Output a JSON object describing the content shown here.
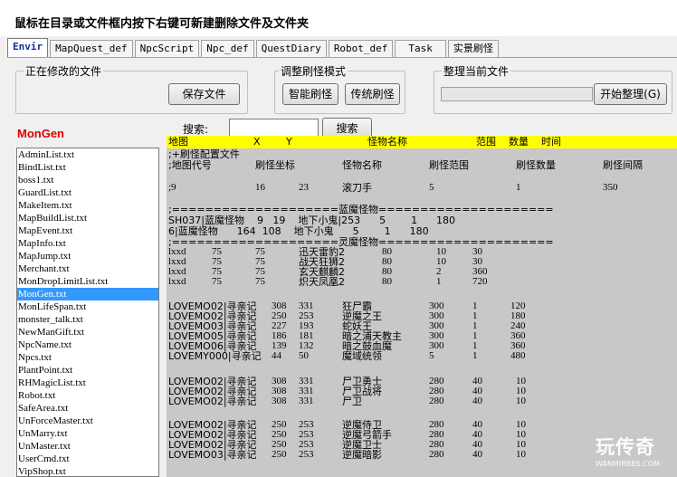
{
  "window": {
    "title": "鼠标在目录或文件框内按下右键可新建删除文件及文件夹"
  },
  "tabs": [
    {
      "label": "Envir",
      "active": true
    },
    {
      "label": "MapQuest_def",
      "active": false
    },
    {
      "label": "NpcScript",
      "active": false
    },
    {
      "label": "Npc_def",
      "active": false
    },
    {
      "label": "QuestDiary",
      "active": false
    },
    {
      "label": "Robot_def",
      "active": false
    },
    {
      "label": "Task",
      "active": false
    },
    {
      "label": "实景刷怪",
      "active": false
    }
  ],
  "editing_group": {
    "label": "正在修改的文件",
    "save_button": "保存文件"
  },
  "mode_group": {
    "label": "调整刷怪模式",
    "smart_button": "智能刷怪",
    "traditional_button": "传统刷怪"
  },
  "tidy_group": {
    "label": "整理当前文件",
    "progress": 0,
    "start_button": "开始整理(G)"
  },
  "current_file_label": "MonGen",
  "search": {
    "label": "搜索:",
    "value": "",
    "button": "搜索"
  },
  "file_list": [
    {
      "name": "AdminList.txt",
      "selected": false
    },
    {
      "name": "BindList.txt",
      "selected": false
    },
    {
      "name": "boss1.txt",
      "selected": false
    },
    {
      "name": "GuardList.txt",
      "selected": false
    },
    {
      "name": "MakeItem.txt",
      "selected": false
    },
    {
      "name": "MapBuildList.txt",
      "selected": false
    },
    {
      "name": "MapEvent.txt",
      "selected": false
    },
    {
      "name": "MapInfo.txt",
      "selected": false
    },
    {
      "name": "MapJump.txt",
      "selected": false
    },
    {
      "name": "Merchant.txt",
      "selected": false
    },
    {
      "name": "MonDropLimitList.txt",
      "selected": false
    },
    {
      "name": "MonGen.txt",
      "selected": true
    },
    {
      "name": "MonLifeSpan.txt",
      "selected": false
    },
    {
      "name": "monster_talk.txt",
      "selected": false
    },
    {
      "name": "NewManGift.txt",
      "selected": false
    },
    {
      "name": "NpcName.txt",
      "selected": false
    },
    {
      "name": "Npcs.txt",
      "selected": false
    },
    {
      "name": "PlantPoint.txt",
      "selected": false
    },
    {
      "name": "RHMagicList.txt",
      "selected": false
    },
    {
      "name": "Robot.txt",
      "selected": false
    },
    {
      "name": "SafeArea.txt",
      "selected": false
    },
    {
      "name": "UnForceMaster.txt",
      "selected": false
    },
    {
      "name": "UnMarry.txt",
      "selected": false
    },
    {
      "name": "UnMaster.txt",
      "selected": false
    },
    {
      "name": "UserCmd.txt",
      "selected": false
    },
    {
      "name": "VipShop.txt",
      "selected": false
    }
  ],
  "content_header": {
    "map": "地图",
    "x": "X",
    "y": "Y",
    "monster": "怪物名称",
    "range": "范围",
    "count": "数量",
    "time": "时间"
  },
  "content_lines": {
    "header_comment": ";+刷怪配置文件",
    "header_cols": [
      ";地图代号",
      "刷怪坐标",
      "怪物名称",
      "刷怪范围",
      "刷怪数量",
      "刷怪间隔"
    ],
    "sample_row": [
      ";9",
      "16",
      "23",
      "滚刀手",
      "5",
      "1",
      "350"
    ],
    "sep1": ";====================蓝魔怪物=====================",
    "row_a": "SH037|蓝魔怪物    9   19    地下小鬼|253      5        1      180",
    "row_b": "6|蓝魔怪物      164  108    地下小鬼      5        1      180",
    "sep2": ";====================灵魔怪物====================="
  },
  "rows_group1": [
    [
      "lxxd",
      "75",
      "75",
      "迅天雷豹2",
      "80",
      "10",
      "30"
    ],
    [
      "lxxd",
      "75",
      "75",
      "战天狂狮2",
      "80",
      "10",
      "30"
    ],
    [
      "lxxd",
      "75",
      "75",
      "玄天麒麟2",
      "80",
      "2",
      "360"
    ],
    [
      "lxxd",
      "75",
      "75",
      "炽天凤凰2",
      "80",
      "1",
      "720"
    ]
  ],
  "rows_group2": [
    [
      "LOVEMO02|寻亲记",
      "308",
      "331",
      "狂尸霸",
      "300",
      "1",
      "120"
    ],
    [
      "LOVEMO02|寻亲记",
      "250",
      "253",
      "逆魔之王",
      "300",
      "1",
      "180"
    ],
    [
      "LOVEMO03|寻亲记",
      "227",
      "193",
      "蛇妖王",
      "300",
      "1",
      "240"
    ],
    [
      "LOVEMO05|寻亲记",
      "186",
      "181",
      "暗之浦天教主",
      "300",
      "1",
      "360"
    ],
    [
      "LOVEMO06|寻亲记",
      "139",
      "132",
      "暗之鼓血魔",
      "300",
      "1",
      "360"
    ],
    [
      "LOVEMY000|寻亲记",
      "44",
      "50",
      "魔域统领",
      "5",
      "1",
      "480"
    ]
  ],
  "rows_group3": [
    [
      "LOVEMO02|寻亲记",
      "308",
      "331",
      "尸卫勇士",
      "280",
      "40",
      "10"
    ],
    [
      "LOVEMO02|寻亲记",
      "308",
      "331",
      "尸卫战将",
      "280",
      "40",
      "10"
    ],
    [
      "LOVEMO02|寻亲记",
      "308",
      "331",
      "尸卫",
      "280",
      "40",
      "10"
    ]
  ],
  "rows_group4": [
    [
      "LOVEMO02|寻亲记",
      "250",
      "253",
      "逆魔侍卫",
      "280",
      "40",
      "10"
    ],
    [
      "LOVEMO02|寻亲记",
      "250",
      "253",
      "逆魔弓箭手",
      "280",
      "40",
      "10"
    ],
    [
      "LOVEMO02|寻亲记",
      "250",
      "253",
      "逆魔卫士",
      "280",
      "40",
      "10"
    ],
    [
      "LOVEMO03|寻亲记",
      "250",
      "253",
      "逆魔暗影",
      "280",
      "40",
      "10"
    ]
  ],
  "watermark": {
    "logo": "玩传奇",
    "url": "WANMIRBBS.COM"
  }
}
